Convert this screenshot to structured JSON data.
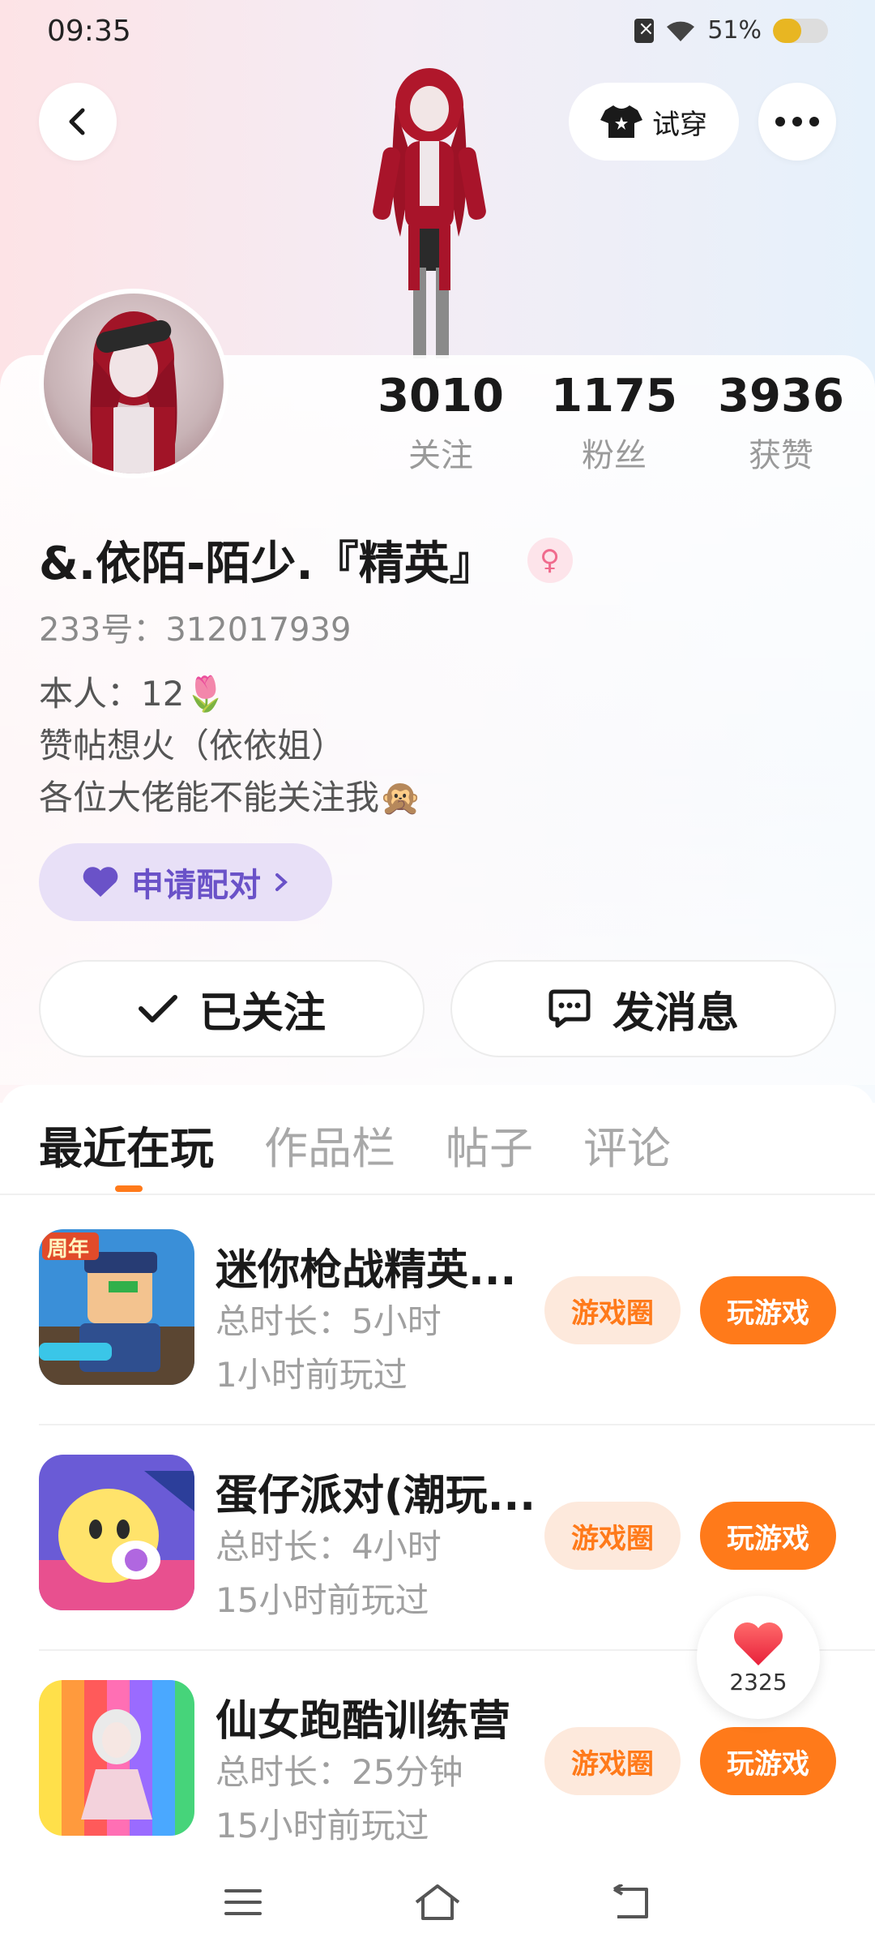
{
  "status_bar": {
    "time": "09:35",
    "battery_text": "51%",
    "battery_level": 0.51,
    "icons": [
      "sim-off-icon",
      "wifi-icon",
      "battery-icon"
    ]
  },
  "header": {
    "back_icon": "chevron-left-icon",
    "tryon_label": "试穿",
    "tryon_icon": "tshirt-icon",
    "more_icon": "more-dots-icon"
  },
  "profile": {
    "stats": [
      {
        "value": "3010",
        "label": "关注"
      },
      {
        "value": "1175",
        "label": "粉丝"
      },
      {
        "value": "3936",
        "label": "获赞"
      }
    ],
    "username": "&.依陌-陌少.『精英』",
    "gender_icon": "female-icon",
    "uid": "233号：312017939",
    "bio_lines": [
      "本人：12🌷",
      "赞帖想火（依依姐）",
      "各位大佬能不能关注我🙊"
    ],
    "pair_label": "申请配对",
    "follow_label": "已关注",
    "message_label": "发消息"
  },
  "tabs": [
    {
      "label": "最近在玩",
      "active": true
    },
    {
      "label": "作品栏",
      "active": false
    },
    {
      "label": "帖子",
      "active": false
    },
    {
      "label": "评论",
      "active": false
    }
  ],
  "games": [
    {
      "title": "迷你枪战精英...",
      "duration": "总时长：5小时",
      "last_played": "1小时前玩过",
      "circle_label": "游戏圈",
      "play_label": "玩游戏",
      "badge": "周年"
    },
    {
      "title": "蛋仔派对(潮玩...",
      "duration": "总时长：4小时",
      "last_played": "15小时前玩过",
      "circle_label": "游戏圈",
      "play_label": "玩游戏"
    },
    {
      "title": "仙女跑酷训练营",
      "duration": "总时长：25分钟",
      "last_played": "15小时前玩过",
      "circle_label": "游戏圈",
      "play_label": "玩游戏"
    }
  ],
  "like_button": {
    "count": "2325",
    "icon": "heart-icon"
  },
  "nav_bar": {
    "icons": [
      "menu-icon",
      "home-icon",
      "back-icon"
    ]
  },
  "colors": {
    "accent": "#ff7a1a",
    "pair_purple": "#6a52c8",
    "female_pink": "#f06b8d"
  }
}
